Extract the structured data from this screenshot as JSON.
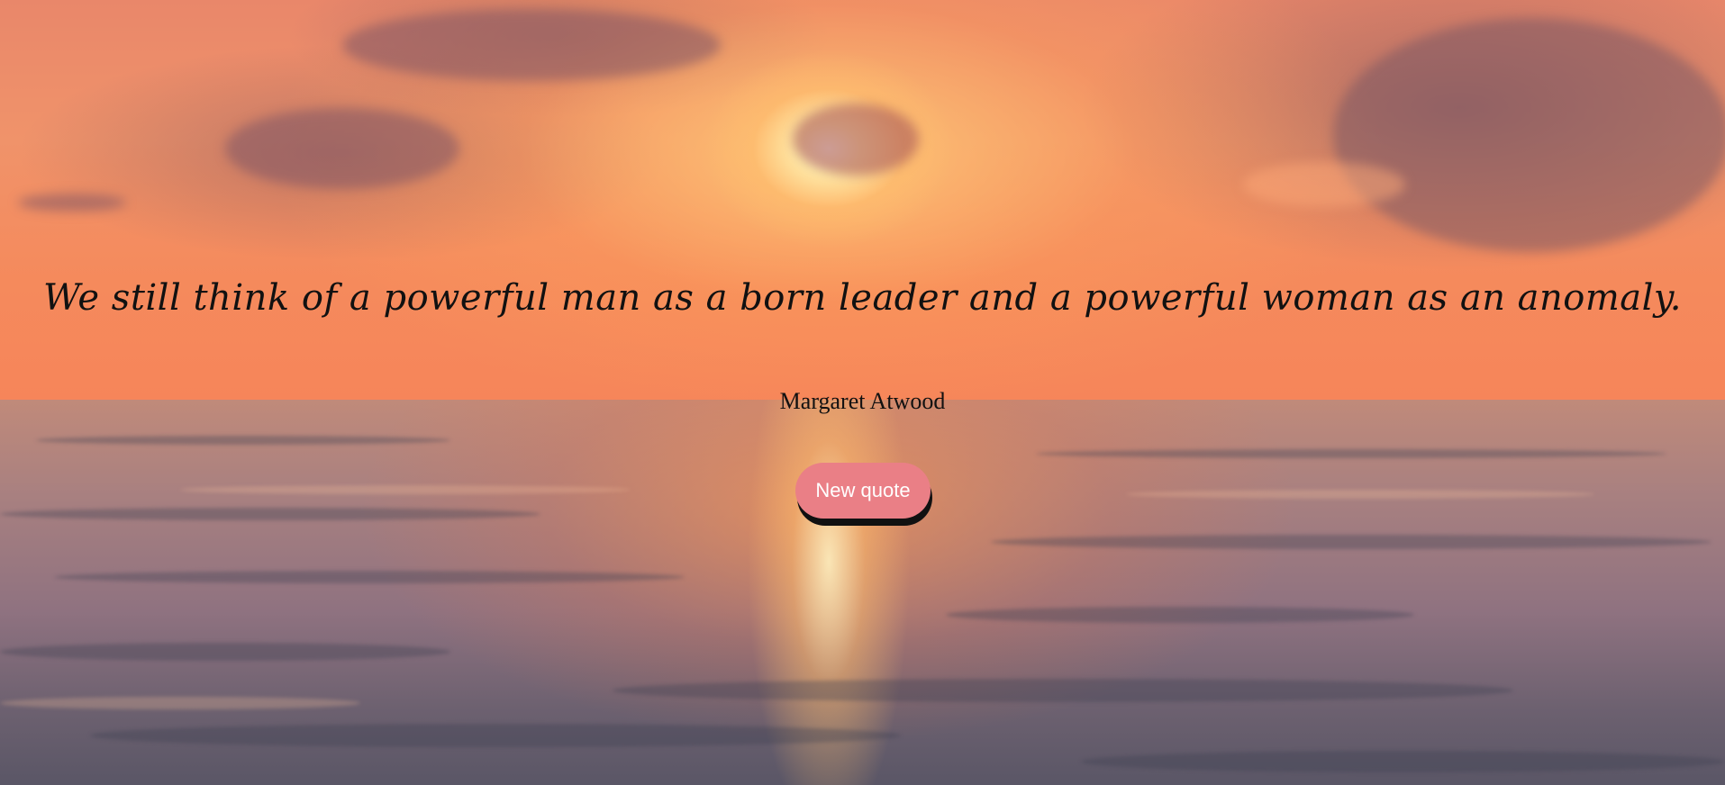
{
  "quote": {
    "text": "We still think of a powerful man as a born leader and a powerful woman as an anomaly.",
    "author": "Margaret Atwood"
  },
  "actions": {
    "new_quote_label": "New quote"
  },
  "colors": {
    "button_background": "#ea7f86",
    "button_text": "#ffffff",
    "text": "#111111"
  },
  "background": {
    "scene": "sunset over ocean"
  }
}
